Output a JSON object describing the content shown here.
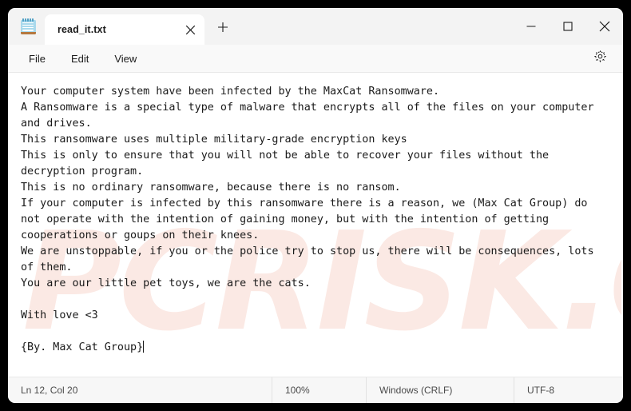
{
  "window": {
    "app_name": "Notepad",
    "app_icon": "notepad-icon",
    "controls": {
      "minimize": "minimize-icon",
      "maximize": "maximize-icon",
      "close": "close-icon"
    }
  },
  "tabs": [
    {
      "title": "read_it.txt",
      "active": true,
      "close_icon": "close-icon"
    }
  ],
  "new_tab": {
    "label": "+",
    "icon": "plus-icon"
  },
  "menu": {
    "items": [
      {
        "label": "File"
      },
      {
        "label": "Edit"
      },
      {
        "label": "View"
      }
    ],
    "settings_icon": "gear-icon"
  },
  "editor": {
    "content": "Your computer system have been infected by the MaxCat Ransomware.\nA Ransomware is a special type of malware that encrypts all of the files on your computer and drives.\nThis ransomware uses multiple military-grade encryption keys\nThis is only to ensure that you will not be able to recover your files without the decryption program.\nThis is no ordinary ransomware, because there is no ransom.\nIf your computer is infected by this ransomware there is a reason, we (Max Cat Group) do not operate with the intention of gaining money, but with the intention of getting cooperations or goups on their knees.\nWe are unstoppable, if you or the police try to stop us, there will be consequences, lots of them.\nYou are our little pet toys, we are the cats.\n\nWith love <3\n\n{By. Max Cat Group}",
    "caret_visible": true
  },
  "watermark": {
    "text": "PCRISK.COM",
    "color": "#fbe9e4"
  },
  "statusbar": {
    "cursor_position": "Ln 12, Col 20",
    "zoom": "100%",
    "line_ending": "Windows (CRLF)",
    "encoding": "UTF-8"
  },
  "colors": {
    "titlebar_bg": "#f3f3f3",
    "menubar_bg": "#f9f9f9",
    "editor_bg": "#ffffff",
    "statusbar_bg": "#f7f7f7",
    "text": "#1a1a1a",
    "desktop_bg": "#000000"
  }
}
